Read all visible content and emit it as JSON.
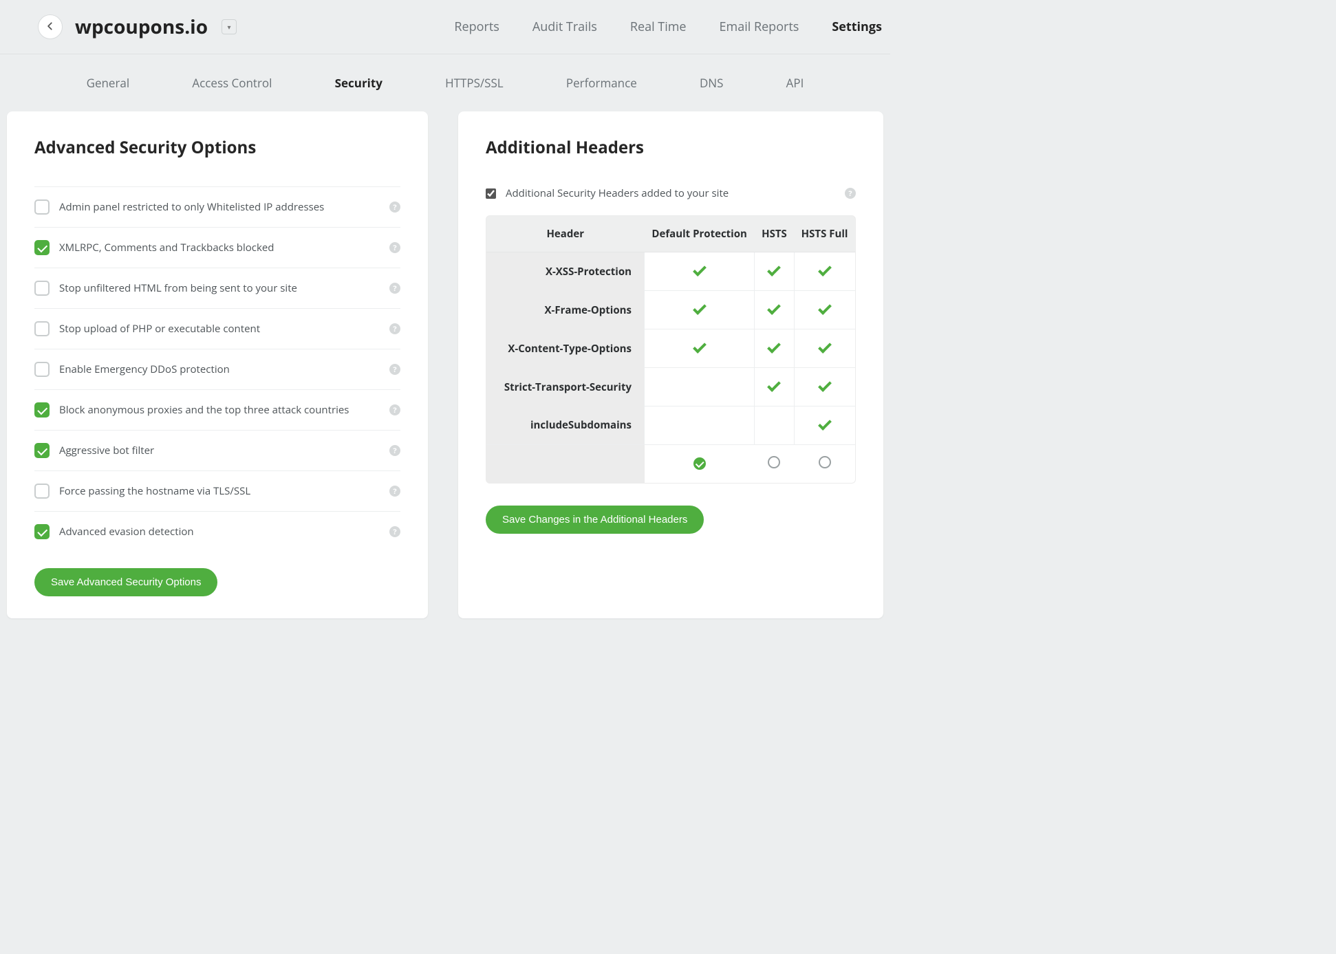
{
  "header": {
    "site_title": "wpcoupons.io",
    "nav": [
      {
        "label": "Reports",
        "active": false
      },
      {
        "label": "Audit Trails",
        "active": false
      },
      {
        "label": "Real Time",
        "active": false
      },
      {
        "label": "Email Reports",
        "active": false
      },
      {
        "label": "Settings",
        "active": true
      }
    ]
  },
  "subtabs": [
    {
      "label": "General",
      "active": false
    },
    {
      "label": "Access Control",
      "active": false
    },
    {
      "label": "Security",
      "active": true
    },
    {
      "label": "HTTPS/SSL",
      "active": false
    },
    {
      "label": "Performance",
      "active": false
    },
    {
      "label": "DNS",
      "active": false
    },
    {
      "label": "API",
      "active": false
    }
  ],
  "security_panel": {
    "title": "Advanced Security Options",
    "options": [
      {
        "label": "Admin panel restricted to only Whitelisted IP addresses",
        "checked": false
      },
      {
        "label": "XMLRPC, Comments and Trackbacks blocked",
        "checked": true
      },
      {
        "label": "Stop unfiltered HTML from being sent to your site",
        "checked": false
      },
      {
        "label": "Stop upload of PHP or executable content",
        "checked": false
      },
      {
        "label": "Enable Emergency DDoS protection",
        "checked": false
      },
      {
        "label": "Block anonymous proxies and the top three attack countries",
        "checked": true
      },
      {
        "label": "Aggressive bot filter",
        "checked": true
      },
      {
        "label": "Force passing the hostname via TLS/SSL",
        "checked": false
      },
      {
        "label": "Advanced evasion detection",
        "checked": true
      }
    ],
    "save_label": "Save Advanced Security Options"
  },
  "headers_panel": {
    "title": "Additional Headers",
    "toggle_label": "Additional Security Headers added to your site",
    "toggle_checked": true,
    "columns": [
      "Header",
      "Default Protection",
      "HSTS",
      "HSTS Full"
    ],
    "rows": [
      {
        "name": "X-XSS-Protection",
        "cells": [
          true,
          true,
          true
        ]
      },
      {
        "name": "X-Frame-Options",
        "cells": [
          true,
          true,
          true
        ]
      },
      {
        "name": "X-Content-Type-Options",
        "cells": [
          true,
          true,
          true
        ]
      },
      {
        "name": "Strict-Transport-Security",
        "cells": [
          false,
          true,
          true
        ]
      },
      {
        "name": "includeSubdomains",
        "cells": [
          false,
          false,
          true
        ]
      }
    ],
    "selected_column": 0,
    "save_label": "Save Changes in the Additional Headers"
  },
  "help_glyph": "?"
}
